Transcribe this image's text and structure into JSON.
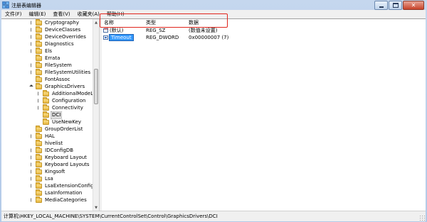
{
  "window": {
    "title": "注册表编辑器"
  },
  "menu": [
    "文件(F)",
    "编辑(E)",
    "查看(V)",
    "收藏夹(A)",
    "帮助(H)"
  ],
  "caption_buttons": {
    "minimize_icon": "minimize-icon",
    "maximize_icon": "maximize-icon",
    "close_icon": "close-icon",
    "close_glyph": "✕"
  },
  "tree": {
    "items": [
      {
        "label": "Cryptography",
        "state": "collapsed"
      },
      {
        "label": "DeviceClasses",
        "state": "collapsed"
      },
      {
        "label": "DeviceOverrides",
        "state": "collapsed"
      },
      {
        "label": "Diagnostics",
        "state": "collapsed"
      },
      {
        "label": "Els",
        "state": "collapsed"
      },
      {
        "label": "Errata",
        "state": "none"
      },
      {
        "label": "FileSystem",
        "state": "collapsed"
      },
      {
        "label": "FileSystemUtilities",
        "state": "collapsed"
      },
      {
        "label": "FontAssoc",
        "state": "none"
      },
      {
        "label": "GraphicsDrivers",
        "state": "expanded"
      },
      {
        "label": "AdditionalModeLists",
        "state": "collapsed"
      },
      {
        "label": "Configuration",
        "state": "collapsed"
      },
      {
        "label": "Connectivity",
        "state": "collapsed"
      },
      {
        "label": "DCI",
        "state": "none",
        "selected": true
      },
      {
        "label": "UseNewKey",
        "state": "none"
      },
      {
        "label": "GroupOrderList",
        "state": "none"
      },
      {
        "label": "HAL",
        "state": "collapsed"
      },
      {
        "label": "hivelist",
        "state": "none"
      },
      {
        "label": "IDConfigDB",
        "state": "collapsed"
      },
      {
        "label": "Keyboard Layout",
        "state": "collapsed"
      },
      {
        "label": "Keyboard Layouts",
        "state": "collapsed"
      },
      {
        "label": "Kingsoft",
        "state": "collapsed"
      },
      {
        "label": "Lsa",
        "state": "collapsed"
      },
      {
        "label": "LsaExtensionConfig",
        "state": "collapsed"
      },
      {
        "label": "LsaInformation",
        "state": "none"
      },
      {
        "label": "MediaCategories",
        "state": "collapsed"
      }
    ]
  },
  "list": {
    "headers": {
      "name": "名称",
      "type": "类型",
      "data": "数据"
    },
    "rows": [
      {
        "name": "(默认)",
        "type": "REG_SZ",
        "data": "(数值未设置)",
        "icon": "string-value-icon",
        "editing": false
      },
      {
        "name": "Timeout",
        "type": "REG_DWORD",
        "data": "0x00000007 (7)",
        "icon": "dword-value-icon",
        "editing": true
      }
    ]
  },
  "status": {
    "path": "计算机\\HKEY_LOCAL_MACHINE\\SYSTEM\\CurrentControlSet\\Control\\GraphicsDrivers\\DCI"
  },
  "colors": {
    "highlight_box": "#e0251c",
    "selection": "#3399ff",
    "title_bg": "#c5d7ee"
  }
}
